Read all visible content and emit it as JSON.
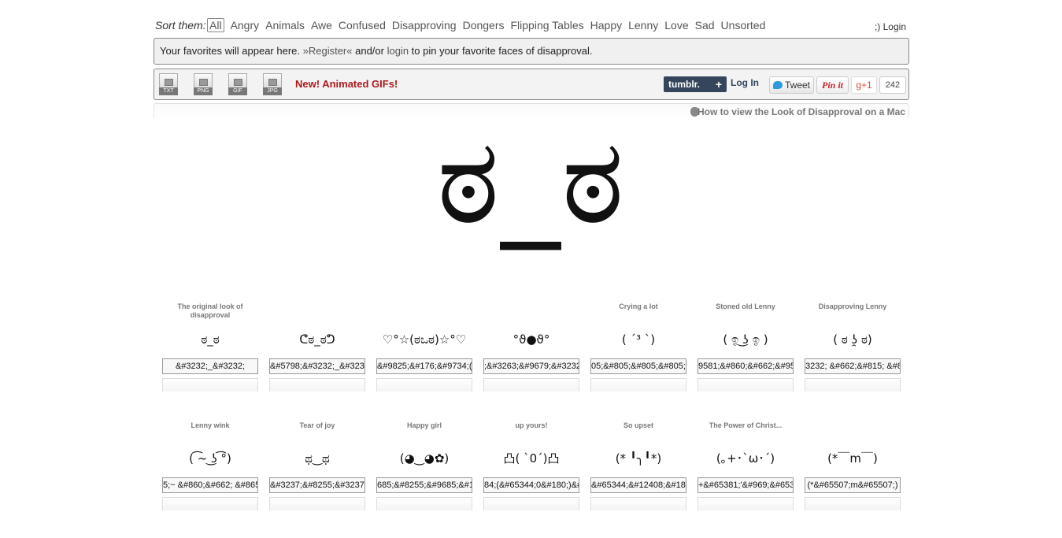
{
  "nav": {
    "sort_label": "Sort them:",
    "categories": [
      "All",
      "Angry",
      "Animals",
      "Awe",
      "Confused",
      "Disapproving",
      "Dongers",
      "Flipping Tables",
      "Happy",
      "Lenny",
      "Love",
      "Sad",
      "Unsorted"
    ],
    "login": ";) Login"
  },
  "favorites": {
    "text_before": "Your favorites will appear here. ",
    "register": "»Register«",
    "and_or": " and/or ",
    "login": "login",
    "text_after": " to pin your favorite faces of disapproval."
  },
  "toolbar": {
    "downloads": [
      "TXT",
      "PNG",
      "GIF",
      "JPG"
    ],
    "new_gifs": "New! Animated GIFs!",
    "tumblr": "tumblr.",
    "tumblr_plus": "+",
    "tumblr_login": "Log In",
    "tweet": "Tweet",
    "pinit": "Pin it",
    "gplus": "g+1",
    "gplus_count": "242"
  },
  "mac_link": "How to view the Look of Disapproval on a Mac",
  "hero_face": "ಠ_ಠ",
  "faces": [
    {
      "title": "The original look of disapproval",
      "face": "ಠ_ಠ",
      "code": "&#3232;_&#3232;"
    },
    {
      "title": "",
      "face": "ᕦಠ_ಠᕤ",
      "code": "&#5798;&#3232;_&#3232;&#5796;"
    },
    {
      "title": "",
      "face": "♡°☆(ಠಒಠ)☆°♡",
      "code": "&#9825;&#176;&#9734;(&#3232;"
    },
    {
      "title": "",
      "face": "°ϑ●ϑ°",
      "code": ";&#3263;&#9679;&#3232;"
    },
    {
      "title": "Crying a lot",
      "face": "( ˊ³ ˋ)",
      "code": "05;&#805;&#805;&#805;&#"
    },
    {
      "title": "Stoned old Lenny",
      "face": "( ඉ ͜ʖ ඉ )",
      "code": "9581;&#860;&#662;&#95"
    },
    {
      "title": "Disapproving Lenny",
      "face": "( ಠ ʖ̯ ಠ)",
      "code": "3232; &#662;&#815; &#8"
    },
    {
      "title": "Lenny wink",
      "face": "( ͡~ ͜ʖ ͡°)",
      "code": "5;~ &#860;&#662; &#865;"
    },
    {
      "title": "Tear of joy",
      "face": "ಥ‿ಥ",
      "code": "&#3237;&#8255;&#3237;"
    },
    {
      "title": "Happy girl",
      "face": "(◕‿◕✿)",
      "code": "685;&#8255;&#9685;&#1"
    },
    {
      "title": "up yours!",
      "face": "凸( `0´)凸",
      "code": "84;(&#65344;0&#180;)&#"
    },
    {
      "title": "So upset",
      "face": "(* ╹╮╹*)",
      "code": "&#65344;&#12408;&#180"
    },
    {
      "title": "The Power of Christ...",
      "face": "(｡+･`ω･´)",
      "code": "+&#65381;'&#969;&#653"
    },
    {
      "title": "",
      "face": "(*￣m￣)",
      "code": "(*&#65507;m&#65507;)"
    }
  ]
}
